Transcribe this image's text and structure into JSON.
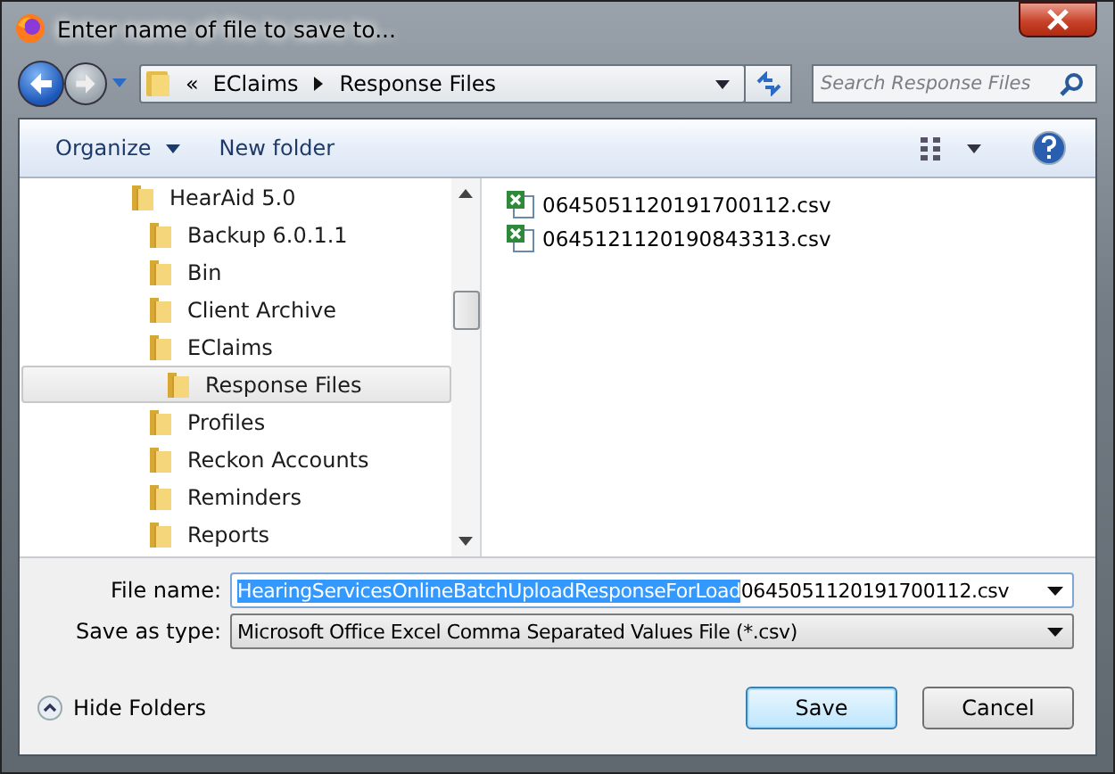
{
  "window": {
    "title": "Enter name of file to save to..."
  },
  "address_bar": {
    "overflow": "«",
    "crumbs": [
      "EClaims",
      "Response Files"
    ]
  },
  "search": {
    "placeholder": "Search Response Files"
  },
  "toolbar": {
    "organize": "Organize",
    "new_folder": "New folder"
  },
  "tree": [
    {
      "label": "HearAid 5.0",
      "selected": false,
      "children": [
        {
          "label": "Backup 6.0.1.1",
          "selected": false
        },
        {
          "label": "Bin",
          "selected": false
        },
        {
          "label": "Client Archive",
          "selected": false
        },
        {
          "label": "EClaims",
          "selected": false,
          "children": [
            {
              "label": "Response Files",
              "selected": true
            }
          ]
        },
        {
          "label": "Profiles",
          "selected": false
        },
        {
          "label": "Reckon Accounts",
          "selected": false
        },
        {
          "label": "Reminders",
          "selected": false
        },
        {
          "label": "Reports",
          "selected": false
        }
      ]
    }
  ],
  "files": [
    "0645051120191700112.csv",
    "0645121120190843313.csv"
  ],
  "file_name": {
    "label": "File name:",
    "selected_text": "HearingServicesOnlineBatchUploadResponseForLoad",
    "rest_text": "0645051120191700112.csv"
  },
  "save_type": {
    "label": "Save as type:",
    "value": "Microsoft Office Excel Comma Separated Values File (*.csv)"
  },
  "hide_folders": "Hide Folders",
  "buttons": [
    {
      "label": "Save",
      "kind": "default"
    },
    {
      "label": "Cancel",
      "kind": "normal"
    }
  ]
}
